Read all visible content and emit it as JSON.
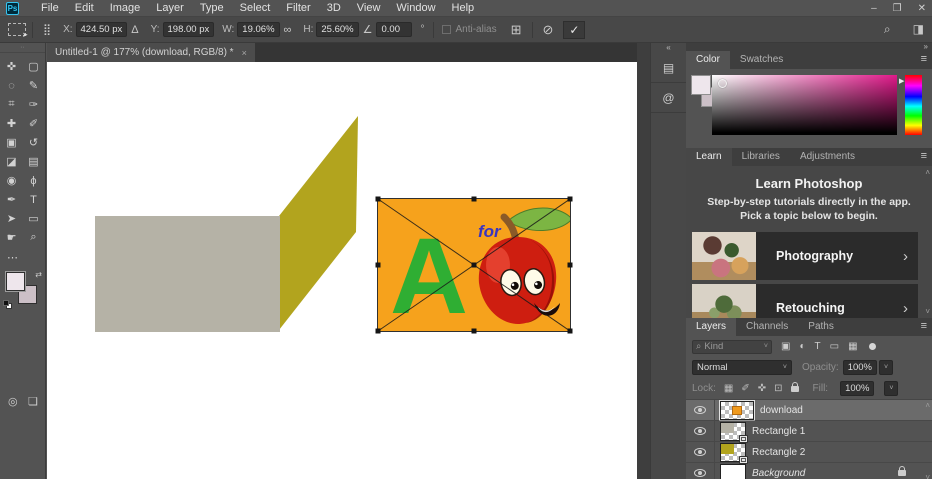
{
  "app": {
    "logo_text": "Ps"
  },
  "menubar": {
    "items": [
      "File",
      "Edit",
      "Image",
      "Layer",
      "Type",
      "Select",
      "Filter",
      "3D",
      "View",
      "Window",
      "Help"
    ]
  },
  "window_controls": {
    "minimize": "–",
    "restore": "❐",
    "close": "✕"
  },
  "options_bar": {
    "reference_point_icon": "⣿",
    "x_label": "X:",
    "x_value": "424.50 px",
    "delta_icon": "Δ",
    "y_label": "Y:",
    "y_value": "198.00 px",
    "w_label": "W:",
    "w_value": "19.06%",
    "link_icon": "∞",
    "h_label": "H:",
    "h_value": "25.60%",
    "angle_icon": "∠",
    "angle_value": "0.00",
    "degree_symbol": "°",
    "anti_alias_label": "Anti-alias",
    "warp_icon": "⊞",
    "cancel_icon": "⊘",
    "commit_icon": "✓",
    "search_icon": "⌕",
    "workspace_icon": "◨"
  },
  "document_tab": {
    "title": "Untitled-1 @ 177% (download, RGB/8) *",
    "close": "×"
  },
  "toolbar": {
    "grip": "··",
    "more_icon": "⋯",
    "swap_icon": "⇄",
    "tools": [
      {
        "name": "move",
        "glyph": "✜"
      },
      {
        "name": "rectangular-marquee",
        "glyph": "▢"
      },
      {
        "name": "lasso",
        "glyph": "◌"
      },
      {
        "name": "quick-selection",
        "glyph": "✎"
      },
      {
        "name": "crop",
        "glyph": "⌗"
      },
      {
        "name": "eyedropper",
        "glyph": "✑"
      },
      {
        "name": "spot-healing-brush",
        "glyph": "✚"
      },
      {
        "name": "brush",
        "glyph": "✐"
      },
      {
        "name": "clone-stamp",
        "glyph": "▣"
      },
      {
        "name": "history-brush",
        "glyph": "↺"
      },
      {
        "name": "eraser",
        "glyph": "◪"
      },
      {
        "name": "gradient",
        "glyph": "▤"
      },
      {
        "name": "blur",
        "glyph": "◉"
      },
      {
        "name": "dodge",
        "glyph": "ϕ"
      },
      {
        "name": "pen",
        "glyph": "✒"
      },
      {
        "name": "type",
        "glyph": "T"
      },
      {
        "name": "path-selection",
        "glyph": "➤"
      },
      {
        "name": "rectangle-shape",
        "glyph": "▭"
      },
      {
        "name": "hand",
        "glyph": "☛"
      },
      {
        "name": "zoom",
        "glyph": "⌕"
      }
    ],
    "mask_mode_icon": "◎",
    "screen_mode_icon": "❏"
  },
  "canvas": {
    "background_color": "#ffffff",
    "gray_rect_color": "#b5b2a6",
    "parallelogram_color": "#b2a41e",
    "placed_image": {
      "background_color": "#f6a21c",
      "letter": "A",
      "letter_color": "#2fae33",
      "word": "for",
      "word_color": "#3a35c0",
      "apple_color": "#ce1e10",
      "leaf_color": "#7cb543",
      "stem_color": "#8a5a28"
    }
  },
  "icon_dock": {
    "collapse_icon": "«",
    "panel_icons": [
      {
        "name": "history",
        "glyph": "▤"
      },
      {
        "name": "comments",
        "glyph": "@"
      }
    ]
  },
  "panel_dock": {
    "collapse_icon": "»"
  },
  "color_panel": {
    "tabs": [
      "Color",
      "Swatches"
    ],
    "menu_icon": "≡",
    "hue_arrow": "▶"
  },
  "learn_panel": {
    "tabs": [
      "Learn",
      "Libraries",
      "Adjustments"
    ],
    "menu_icon": "≡",
    "title": "Learn Photoshop",
    "subtitle": "Step-by-step tutorials directly in the app. Pick a topic below to begin.",
    "cards": [
      {
        "label": "Photography"
      },
      {
        "label": "Retouching"
      }
    ],
    "chevron": "›",
    "scroll_up": "˄",
    "scroll_down": "˅"
  },
  "layers_panel": {
    "tabs": [
      "Layers",
      "Channels",
      "Paths"
    ],
    "menu_icon": "≡",
    "filter": {
      "search_icon": "⌕",
      "kind_label": "Kind",
      "dropdown": "˅",
      "pixel_icon": "▣",
      "adjustment_icon": "◐",
      "type_icon": "T",
      "shape_icon": "▭",
      "smart_icon": "▦"
    },
    "blend_mode_value": "Normal",
    "dropdown": "˅",
    "opacity_label": "Opacity:",
    "opacity_value": "100%",
    "lock_label": "Lock:",
    "lock_icons": {
      "transparency": "▦",
      "pixels": "✐",
      "position": "✜",
      "artboard": "⊡"
    },
    "fill_label": "Fill:",
    "fill_value": "100%",
    "layers": [
      {
        "name": "download"
      },
      {
        "name": "Rectangle 1"
      },
      {
        "name": "Rectangle 2"
      },
      {
        "name": "Background"
      }
    ],
    "scroll_up": "˄",
    "scroll_down": "˅"
  }
}
